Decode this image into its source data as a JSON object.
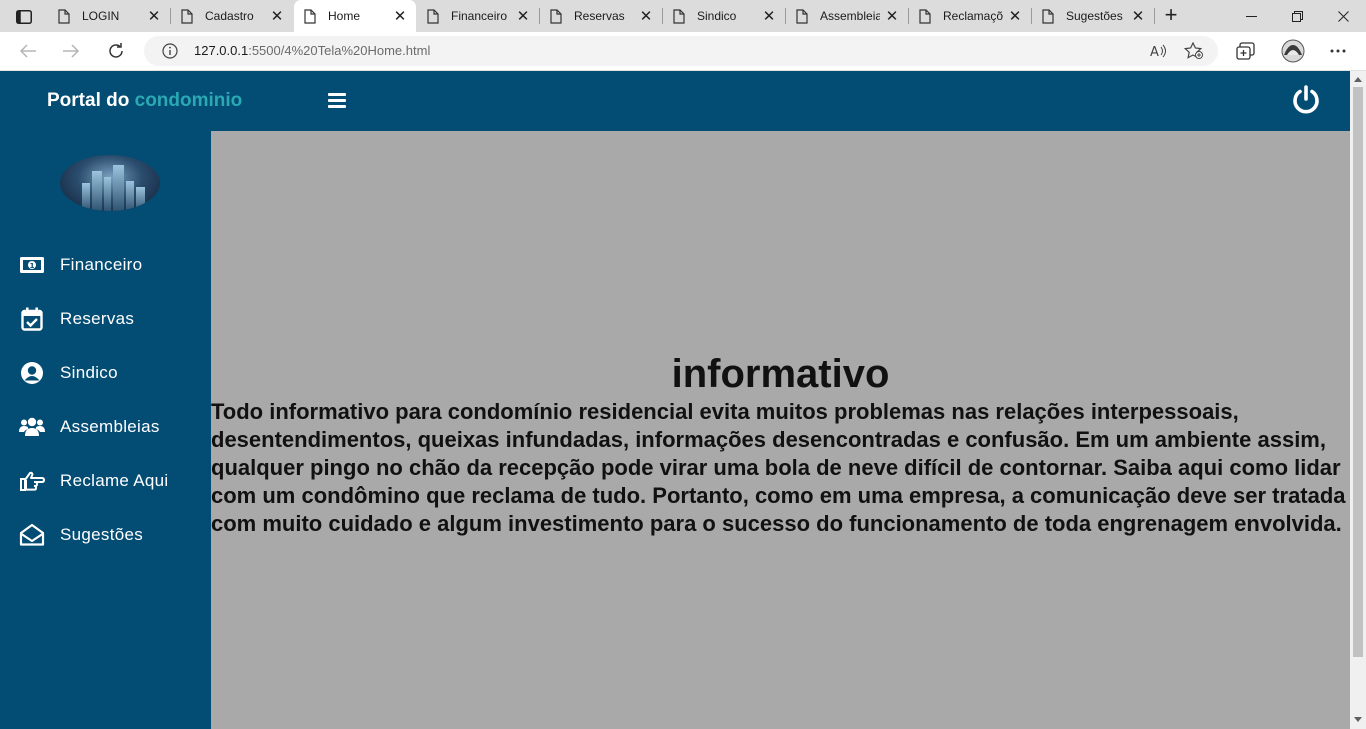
{
  "browser": {
    "tabs": [
      {
        "title": "LOGIN"
      },
      {
        "title": "Cadastro"
      },
      {
        "title": "Home"
      },
      {
        "title": "Financeiro"
      },
      {
        "title": "Reservas"
      },
      {
        "title": "Sindico"
      },
      {
        "title": "Assembleias"
      },
      {
        "title": "Reclamações"
      },
      {
        "title": "Sugestões"
      }
    ],
    "active_tab": "Home",
    "url_host": "127.0.0.1",
    "url_rest": ":5500/4%20Tela%20Home.html"
  },
  "header": {
    "brand_part1": "Portal do",
    "brand_part2": "condominio",
    "accent_color": "#2aa9b3",
    "bar_color": "#034c74"
  },
  "sidebar": {
    "items": [
      {
        "label": "Financeiro",
        "icon": "money-bill-icon"
      },
      {
        "label": "Reservas",
        "icon": "calendar-check-icon"
      },
      {
        "label": "Sindico",
        "icon": "user-circle-icon"
      },
      {
        "label": "Assembleias",
        "icon": "users-icon"
      },
      {
        "label": "Reclame Aqui",
        "icon": "hand-point-icon"
      },
      {
        "label": "Sugestões",
        "icon": "envelope-open-icon"
      }
    ]
  },
  "main": {
    "title": "informativo",
    "text": "Todo informativo para condomínio residencial evita muitos problemas nas relações interpessoais, desentendimentos, queixas infundadas, informações desencontradas e confusão. Em um ambiente assim, qualquer pingo no chão da recepção pode virar uma bola de neve difícil de contornar. Saiba aqui como lidar com um condômino que reclama de tudo. Portanto, como em uma empresa, a comunicação deve ser tratada com muito cuidado e algum investimento para o sucesso do funcionamento de toda engrenagem envolvida."
  }
}
